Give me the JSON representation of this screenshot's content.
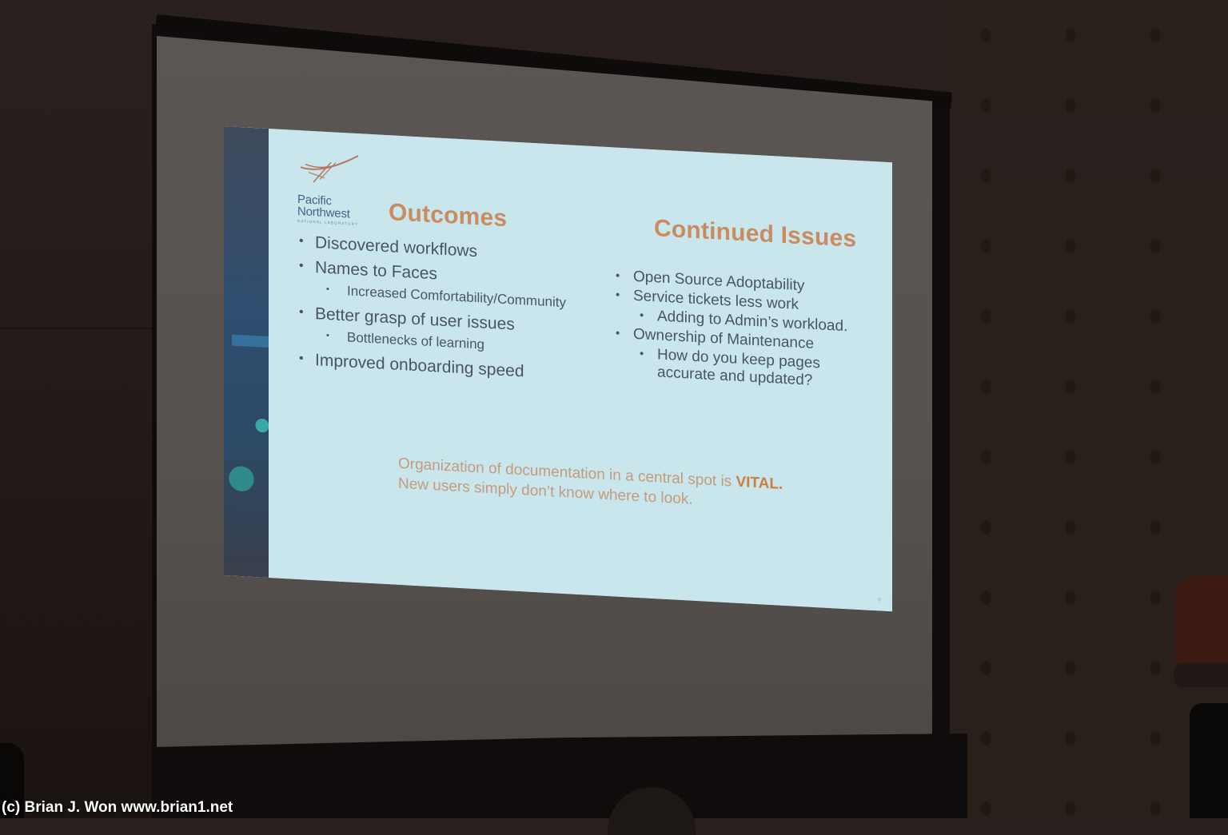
{
  "scene": {
    "description": "Photograph of a projected presentation slide in a dim conference room",
    "wall_color": "#2a211e",
    "screen_color": "#57514f",
    "slide_background": "#c8e6ec"
  },
  "slide": {
    "logo": {
      "line1": "Pacific",
      "line2": "Northwest",
      "subtitle": "NATIONAL LABORATORY",
      "icon": "pnnl-logo-icon"
    },
    "accent_color": "#c98b60",
    "body_color": "#4a5468",
    "outcomes": {
      "title": "Outcomes",
      "items": [
        {
          "level": 1,
          "text": "Discovered workflows"
        },
        {
          "level": 1,
          "text": "Names to Faces"
        },
        {
          "level": 2,
          "text": "Increased Comfortability/Community"
        },
        {
          "level": 1,
          "text": "Better grasp of user issues"
        },
        {
          "level": 2,
          "text": "Bottlenecks of learning"
        },
        {
          "level": 1,
          "text": "Improved onboarding speed"
        }
      ]
    },
    "continued_issues": {
      "title": "Continued Issues",
      "items": [
        {
          "level": 1,
          "text": "Open Source Adoptability"
        },
        {
          "level": 1,
          "text": "Service tickets less work"
        },
        {
          "level": 2,
          "text": "Adding to Admin’s workload."
        },
        {
          "level": 1,
          "text": "Ownership of Maintenance"
        },
        {
          "level": 2,
          "text": "How do you keep pages accurate and updated?"
        }
      ]
    },
    "takeaway": {
      "line1_prefix": "Organization of documentation in a central spot is ",
      "line1_emphasis": "VITAL.",
      "line2": "New users simply don’t know where to look."
    },
    "page_number": "9"
  },
  "watermark": "(c) Brian J. Won www.brian1.net"
}
